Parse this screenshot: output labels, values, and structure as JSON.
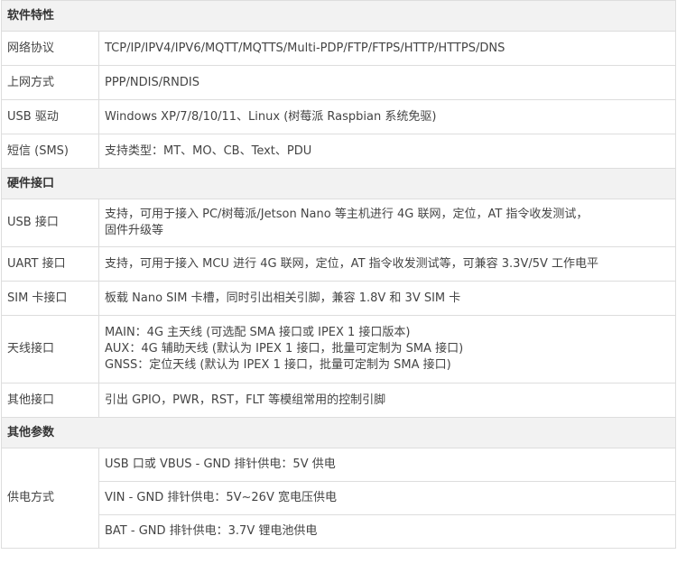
{
  "sections": {
    "software": "软件特性",
    "hardware": "硬件接口",
    "other": "其他参数"
  },
  "rows": {
    "network_protocol": {
      "label": "网络协议",
      "value": "TCP/IP/IPV4/IPV6/MQTT/MQTTS/Multi-PDP/FTP/FTPS/HTTP/HTTPS/DNS"
    },
    "dialup": {
      "label": "上网方式",
      "value": "PPP/NDIS/RNDIS"
    },
    "usb_driver": {
      "label": "USB 驱动",
      "value": "Windows XP/7/8/10/11、Linux (树莓派 Raspbian 系统免驱)"
    },
    "sms": {
      "label": "短信 (SMS)",
      "value": "支持类型：MT、MO、CB、Text、PDU"
    },
    "usb_port": {
      "label": "USB 接口",
      "line1": "支持，可用于接入 PC/树莓派/Jetson Nano 等主机进行 4G 联网，定位，AT 指令收发测试，",
      "line2": "固件升级等"
    },
    "uart_port": {
      "label": "UART 接口",
      "value": "支持，可用于接入 MCU 进行 4G 联网，定位，AT 指令收发测试等，可兼容 3.3V/5V 工作电平"
    },
    "sim_port": {
      "label": "SIM 卡接口",
      "value": "板载 Nano SIM 卡槽，同时引出相关引脚，兼容 1.8V 和 3V SIM 卡"
    },
    "antenna": {
      "label": "天线接口",
      "line1": "MAIN：4G 主天线 (可选配 SMA 接口或 IPEX 1 接口版本)",
      "line2": "AUX：4G 辅助天线 (默认为 IPEX 1 接口，批量可定制为 SMA 接口)",
      "line3": "GNSS：定位天线 (默认为 IPEX 1 接口，批量可定制为 SMA 接口)"
    },
    "other_port": {
      "label": "其他接口",
      "value": "引出 GPIO，PWR，RST，FLT 等模组常用的控制引脚"
    },
    "power": {
      "label": "供电方式",
      "option1": "USB 口或 VBUS - GND 排针供电：5V 供电",
      "option2": "VIN - GND 排针供电：5V~26V 宽电压供电",
      "option3": "BAT - GND 排针供电：3.7V 锂电池供电"
    }
  }
}
